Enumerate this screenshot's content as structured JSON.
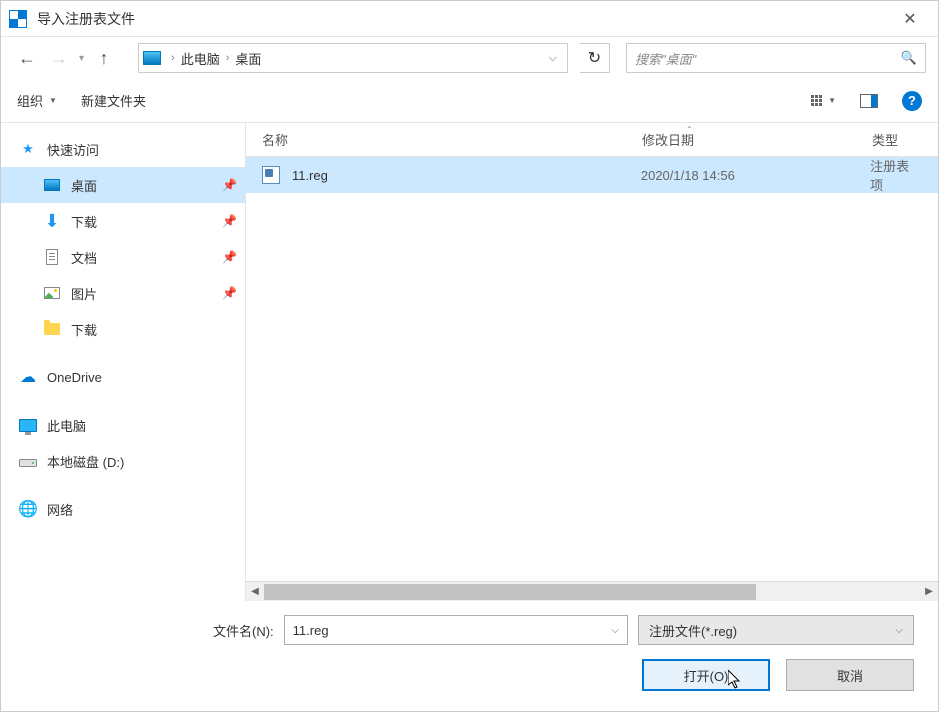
{
  "title": "导入注册表文件",
  "breadcrumb": {
    "sep": "›",
    "items": [
      "此电脑",
      "桌面"
    ]
  },
  "search": {
    "placeholder": "搜索\"桌面\""
  },
  "toolbar": {
    "organize": "组织",
    "new_folder": "新建文件夹"
  },
  "sidebar": {
    "quick_access": "快速访问",
    "desktop": "桌面",
    "downloads": "下载",
    "documents": "文档",
    "pictures": "图片",
    "downloads2": "下载",
    "onedrive": "OneDrive",
    "thispc": "此电脑",
    "localdisk": "本地磁盘 (D:)",
    "network": "网络"
  },
  "columns": {
    "name": "名称",
    "date": "修改日期",
    "type": "类型"
  },
  "files": [
    {
      "name": "11.reg",
      "date": "2020/1/18 14:56",
      "type": "注册表项"
    }
  ],
  "bottom": {
    "filename_label": "文件名(N):",
    "filename_value": "11.reg",
    "filter": "注册文件(*.reg)",
    "open": "打开(O)",
    "cancel": "取消",
    "help": "?"
  }
}
